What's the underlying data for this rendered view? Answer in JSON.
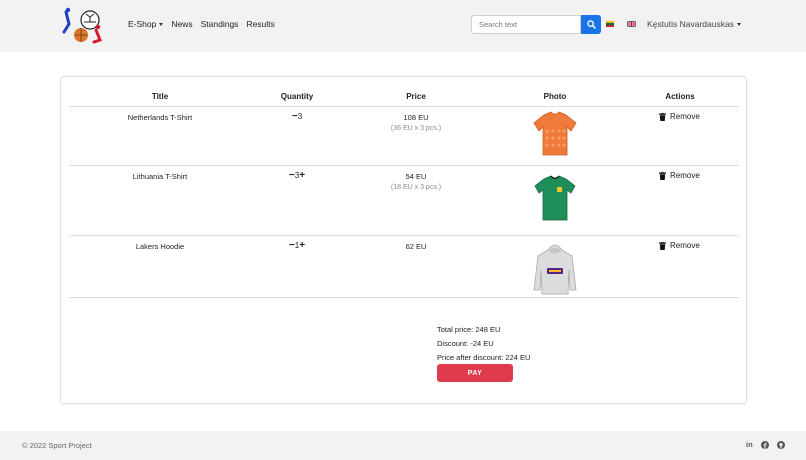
{
  "nav": {
    "eshop": "E-Shop",
    "news": "News",
    "standings": "Standings",
    "results": "Results",
    "search_placeholder": "Search text",
    "user": "Kęstutis Navardauskas"
  },
  "table": {
    "headers": [
      "Title",
      "Quantity",
      "Price",
      "Photo",
      "Actions"
    ],
    "rows": [
      {
        "title": "Netherlands T-Shirt",
        "qty": "3",
        "price": "108 EU",
        "price_detail": "(36 EU x 3 pcs.)",
        "remove": "Remove"
      },
      {
        "title": "Lithuania T-Shirt",
        "qty": "3",
        "price": "54 EU",
        "price_detail": "(18 EU x 3 pcs.)",
        "remove": "Remove"
      },
      {
        "title": "Lakers Hoodie",
        "qty": "1",
        "price": "62 EU",
        "remove": "Remove"
      }
    ]
  },
  "summary": {
    "total": "Total price: 248 EU",
    "discount": "Discount: -24 EU",
    "after": "Price after discount: 224 EU",
    "pay": "PAY"
  },
  "footer": {
    "copyright": "© 2022 Sport Project",
    "linkedin": "in"
  },
  "colors": {
    "accent_blue": "#1a73e8",
    "pay_red": "#e03b4d",
    "netherlands_orange": "#ee7b3a",
    "lithuania_green": "#1f8f5a"
  },
  "icons": [
    "logo-icon",
    "search-icon",
    "lt-flag-icon",
    "gb-flag-icon",
    "trash-icon",
    "linkedin-icon",
    "facebook-icon",
    "github-icon"
  ]
}
